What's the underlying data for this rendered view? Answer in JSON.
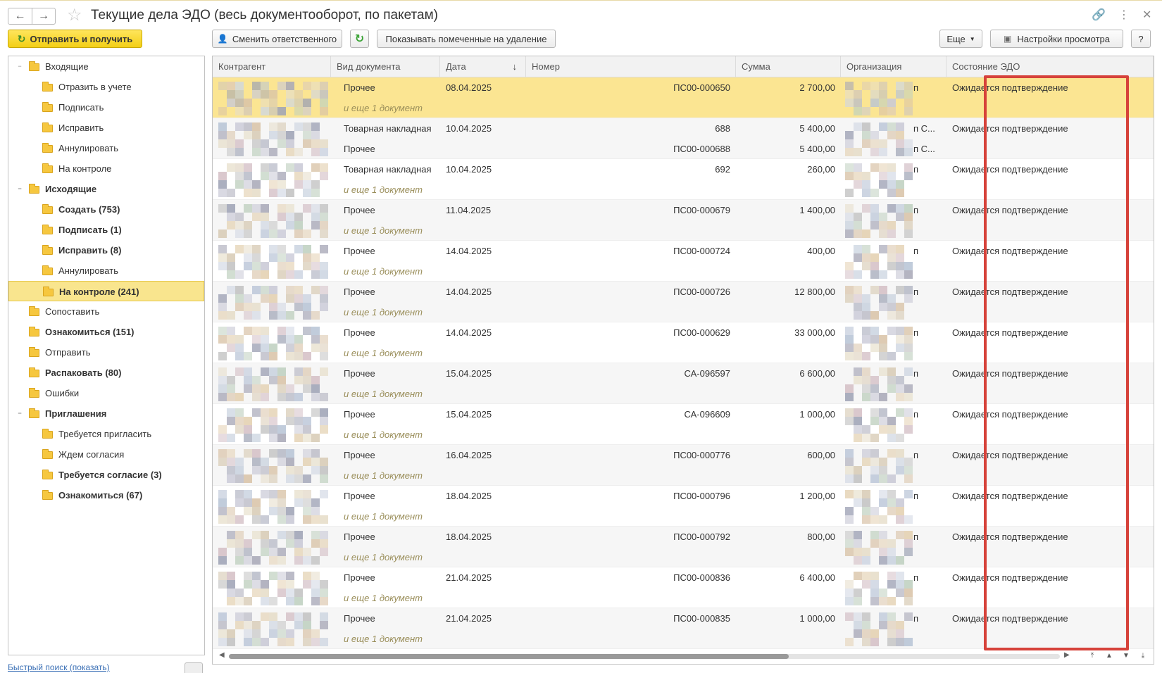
{
  "window": {
    "title": "Текущие дела ЭДО (весь документооборот, по пакетам)"
  },
  "toolbar": {
    "send_receive": "Отправить и получить",
    "change_responsible": "Сменить ответственного",
    "show_deleted": "Показывать помеченные на удаление",
    "more": "Еще",
    "view_settings": "Настройки просмотра",
    "help": "?"
  },
  "tree": [
    {
      "label": "Входящие",
      "level": 0,
      "bold": false,
      "toggle": "⊖"
    },
    {
      "label": "Отразить в учете",
      "level": 1,
      "bold": false
    },
    {
      "label": "Подписать",
      "level": 1,
      "bold": false
    },
    {
      "label": "Исправить",
      "level": 1,
      "bold": false
    },
    {
      "label": "Аннулировать",
      "level": 1,
      "bold": false
    },
    {
      "label": "На контроле",
      "level": 1,
      "bold": false
    },
    {
      "label": "Исходящие",
      "level": 0,
      "bold": true,
      "toggle": "⊖"
    },
    {
      "label": "Создать (753)",
      "level": 1,
      "bold": true
    },
    {
      "label": "Подписать (1)",
      "level": 1,
      "bold": true
    },
    {
      "label": "Исправить (8)",
      "level": 1,
      "bold": true
    },
    {
      "label": "Аннулировать",
      "level": 1,
      "bold": false
    },
    {
      "label": "На контроле (241)",
      "level": 1,
      "bold": true,
      "selected": true
    },
    {
      "label": "Сопоставить",
      "level": 0,
      "bold": false
    },
    {
      "label": "Ознакомиться (151)",
      "level": 0,
      "bold": true
    },
    {
      "label": "Отправить",
      "level": 0,
      "bold": false
    },
    {
      "label": "Распаковать (80)",
      "level": 0,
      "bold": true
    },
    {
      "label": "Ошибки",
      "level": 0,
      "bold": false
    },
    {
      "label": "Приглашения",
      "level": 0,
      "bold": true,
      "toggle": "⊖"
    },
    {
      "label": "Требуется пригласить",
      "level": 1,
      "bold": false
    },
    {
      "label": "Ждем согласия",
      "level": 1,
      "bold": false
    },
    {
      "label": "Требуется согласие (3)",
      "level": 1,
      "bold": true
    },
    {
      "label": "Ознакомиться (67)",
      "level": 1,
      "bold": true
    }
  ],
  "quick_search": "Быстрый поиск (показать)",
  "table": {
    "columns": [
      "Контрагент",
      "Вид документа",
      "Дата",
      "Номер",
      "Сумма",
      "Организация",
      "Состояние ЭДО"
    ],
    "rows": [
      {
        "doc": "Прочее",
        "doc2": "и еще 1 документ",
        "date": "08.04.2025",
        "num": "ПС00-000650",
        "num2": "",
        "sum": "2 700,00",
        "sum2": "",
        "org_tail": "п",
        "org_tail2": "",
        "state": "Ожидается подтверждение",
        "more": true
      },
      {
        "doc": "Товарная накладная",
        "doc2": "Прочее",
        "date": "10.04.2025",
        "num": "688",
        "num2": "ПС00-000688",
        "sum": "5 400,00",
        "sum2": "5 400,00",
        "org_tail": "п С...",
        "org_tail2": "п С...",
        "state": "Ожидается подтверждение",
        "more": false
      },
      {
        "doc": "Товарная накладная",
        "doc2": "и еще 1 документ",
        "date": "10.04.2025",
        "num": "692",
        "num2": "",
        "sum": "260,00",
        "sum2": "",
        "org_tail": "п",
        "org_tail2": "",
        "state": "Ожидается подтверждение",
        "more": true
      },
      {
        "doc": "Прочее",
        "doc2": "и еще 1 документ",
        "date": "11.04.2025",
        "num": "ПС00-000679",
        "num2": "",
        "sum": "1 400,00",
        "sum2": "",
        "org_tail": "п",
        "org_tail2": "",
        "state": "Ожидается подтверждение",
        "more": true
      },
      {
        "doc": "Прочее",
        "doc2": "и еще 1 документ",
        "date": "14.04.2025",
        "num": "ПС00-000724",
        "num2": "",
        "sum": "400,00",
        "sum2": "",
        "org_tail": "п",
        "org_tail2": "",
        "state": "Ожидается подтверждение",
        "more": true
      },
      {
        "doc": "Прочее",
        "doc2": "и еще 1 документ",
        "date": "14.04.2025",
        "num": "ПС00-000726",
        "num2": "",
        "sum": "12 800,00",
        "sum2": "",
        "org_tail": "п",
        "org_tail2": "",
        "state": "Ожидается подтверждение",
        "more": true
      },
      {
        "doc": "Прочее",
        "doc2": "и еще 1 документ",
        "date": "14.04.2025",
        "num": "ПС00-000629",
        "num2": "",
        "sum": "33 000,00",
        "sum2": "",
        "org_tail": "п",
        "org_tail2": "",
        "state": "Ожидается подтверждение",
        "more": true
      },
      {
        "doc": "Прочее",
        "doc2": "и еще 1 документ",
        "date": "15.04.2025",
        "num": "СА-096597",
        "num2": "",
        "sum": "6 600,00",
        "sum2": "",
        "org_tail": "п",
        "org_tail2": "",
        "state": "Ожидается подтверждение",
        "more": true
      },
      {
        "doc": "Прочее",
        "doc2": "и еще 1 документ",
        "date": "15.04.2025",
        "num": "СА-096609",
        "num2": "",
        "sum": "1 000,00",
        "sum2": "",
        "org_tail": "п",
        "org_tail2": "",
        "state": "Ожидается подтверждение",
        "more": true
      },
      {
        "doc": "Прочее",
        "doc2": "и еще 1 документ",
        "date": "16.04.2025",
        "num": "ПС00-000776",
        "num2": "",
        "sum": "600,00",
        "sum2": "",
        "org_tail": "п",
        "org_tail2": "",
        "state": "Ожидается подтверждение",
        "more": true
      },
      {
        "doc": "Прочее",
        "doc2": "и еще 1 документ",
        "date": "18.04.2025",
        "num": "ПС00-000796",
        "num2": "",
        "sum": "1 200,00",
        "sum2": "",
        "org_tail": "п",
        "org_tail2": "",
        "state": "Ожидается подтверждение",
        "more": true
      },
      {
        "doc": "Прочее",
        "doc2": "и еще 1 документ",
        "date": "18.04.2025",
        "num": "ПС00-000792",
        "num2": "",
        "sum": "800,00",
        "sum2": "",
        "org_tail": "п",
        "org_tail2": "",
        "state": "Ожидается подтверждение",
        "more": true
      },
      {
        "doc": "Прочее",
        "doc2": "и еще 1 документ",
        "date": "21.04.2025",
        "num": "ПС00-000836",
        "num2": "",
        "sum": "6 400,00",
        "sum2": "",
        "org_tail": "п",
        "org_tail2": "",
        "state": "Ожидается подтверждение",
        "more": true
      },
      {
        "doc": "Прочее",
        "doc2": "и еще 1 документ",
        "date": "21.04.2025",
        "num": "ПС00-000835",
        "num2": "",
        "sum": "1 000,00",
        "sum2": "",
        "org_tail": "п",
        "org_tail2": "",
        "state": "Ожидается подтверждение",
        "more": true
      }
    ]
  },
  "colors": {
    "accent_yellow": "#f3cf16",
    "selection": "#fbe592",
    "highlight_frame": "#d6423a"
  }
}
